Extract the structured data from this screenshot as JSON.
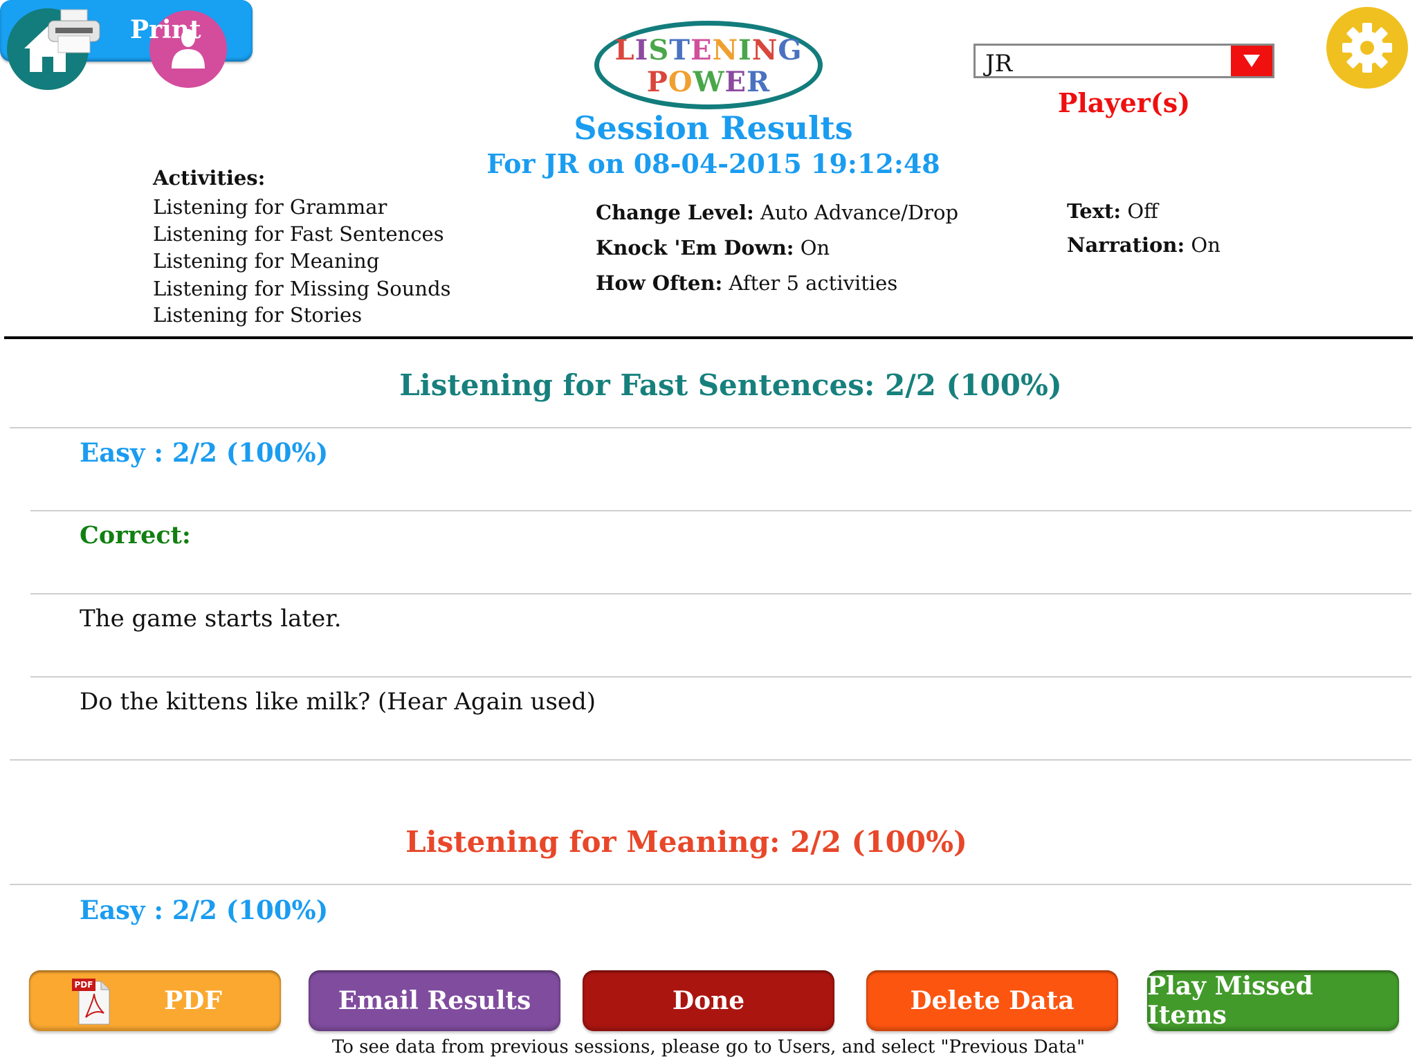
{
  "header": {
    "home_icon": "home-icon",
    "user_icon": "user-icon",
    "settings_icon": "gear-icon",
    "print_button": {
      "label": "Print",
      "icon": "printer-icon"
    },
    "logo": {
      "line1": [
        {
          "ch": "L",
          "color": "#d9463c"
        },
        {
          "ch": "I",
          "color": "#8c4aa0"
        },
        {
          "ch": "S",
          "color": "#4aa64a"
        },
        {
          "ch": "T",
          "color": "#4a72c0"
        },
        {
          "ch": "E",
          "color": "#d0509c"
        },
        {
          "ch": "N",
          "color": "#f0a030"
        },
        {
          "ch": "I",
          "color": "#4aa64a"
        },
        {
          "ch": "N",
          "color": "#d9463c"
        },
        {
          "ch": "G",
          "color": "#4a72c0"
        }
      ],
      "line2": [
        {
          "ch": "P",
          "color": "#d9463c"
        },
        {
          "ch": "O",
          "color": "#f0a030"
        },
        {
          "ch": "W",
          "color": "#4aa64a"
        },
        {
          "ch": "E",
          "color": "#8c4aa0"
        },
        {
          "ch": "R",
          "color": "#4a72c0"
        }
      ]
    },
    "title": "Session Results",
    "subtitle": "For JR on 08-04-2015 19:12:48",
    "player_select": {
      "value": "JR",
      "label": "Player(s)"
    }
  },
  "activities": {
    "heading": "Activities:",
    "items": [
      "Listening for Grammar",
      "Listening for Fast Sentences",
      "Listening for Meaning",
      "Listening for Missing Sounds",
      "Listening for Stories"
    ]
  },
  "settings": {
    "change_level": {
      "label": "Change Level:",
      "value": "Auto Advance/Drop"
    },
    "knock_em_down": {
      "label": "Knock 'Em Down:",
      "value": "On"
    },
    "how_often": {
      "label": "How Often:",
      "value": "After 5 activities"
    },
    "text": {
      "label": "Text:",
      "value": "Off"
    },
    "narration": {
      "label": "Narration:",
      "value": "On"
    }
  },
  "results": [
    {
      "heading": "Listening for Fast Sentences: 2/2  (100%)",
      "color": "#17807d",
      "level": "Easy : 2/2  (100%)",
      "correct_label": "Correct:",
      "items": [
        "The game starts later.",
        "Do the kittens like milk?  (Hear Again used)"
      ]
    },
    {
      "heading": "Listening for Meaning: 2/2  (100%)",
      "color": "#e8472a",
      "level": "Easy : 2/2  (100%)"
    }
  ],
  "buttons": {
    "pdf": {
      "label": "PDF",
      "color": "#fba830"
    },
    "email": {
      "label": "Email Results",
      "color": "#804c9e"
    },
    "done": {
      "label": "Done",
      "color": "#ab1510"
    },
    "delete": {
      "label": "Delete Data",
      "color": "#fc5510"
    },
    "play_missed": {
      "label": "Play Missed Items",
      "color": "#429a2a"
    }
  },
  "footer_note": "To see data from previous sessions, please go to Users, and select \"Previous Data\""
}
